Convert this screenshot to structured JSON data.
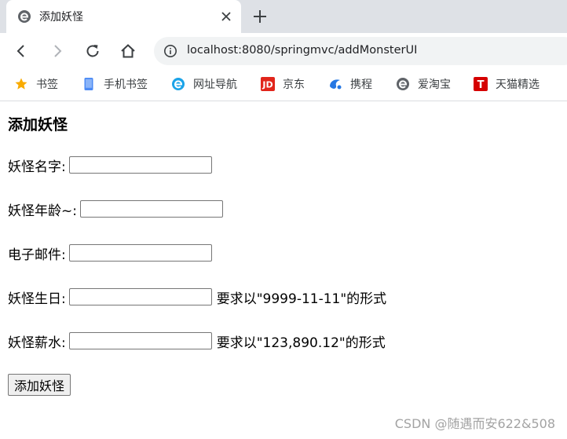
{
  "browser": {
    "tab": {
      "title": "添加妖怪"
    },
    "url": "localhost:8080/springmvc/addMonsterUI",
    "bookmarks": [
      {
        "label": "书签",
        "icon": "star-icon"
      },
      {
        "label": "手机书签",
        "icon": "phone-icon"
      },
      {
        "label": "网址导航",
        "icon": "e-browser-icon"
      },
      {
        "label": "京东",
        "icon": "jd-icon"
      },
      {
        "label": "携程",
        "icon": "ctrip-icon"
      },
      {
        "label": "爱淘宝",
        "icon": "e-browser-icon"
      },
      {
        "label": "天猫精选",
        "icon": "tmall-icon"
      }
    ]
  },
  "page": {
    "heading": "添加妖怪",
    "fields": [
      {
        "label": "妖怪名字:",
        "value": "",
        "hint": ""
      },
      {
        "label": "妖怪年龄~:",
        "value": "",
        "hint": ""
      },
      {
        "label": "电子邮件:",
        "value": "",
        "hint": ""
      },
      {
        "label": "妖怪生日:",
        "value": "",
        "hint": "要求以\"9999-11-11\"的形式"
      },
      {
        "label": "妖怪薪水:",
        "value": "",
        "hint": "要求以\"123,890.12\"的形式"
      }
    ],
    "submit_label": "添加妖怪"
  },
  "watermark": "CSDN @随遇而安622&508",
  "colors": {
    "tabbar": "#dee1e6",
    "omnibox": "#f1f3f4",
    "star": "#f9ab00",
    "jd": "#e1251b",
    "tmall": "#d50000"
  }
}
